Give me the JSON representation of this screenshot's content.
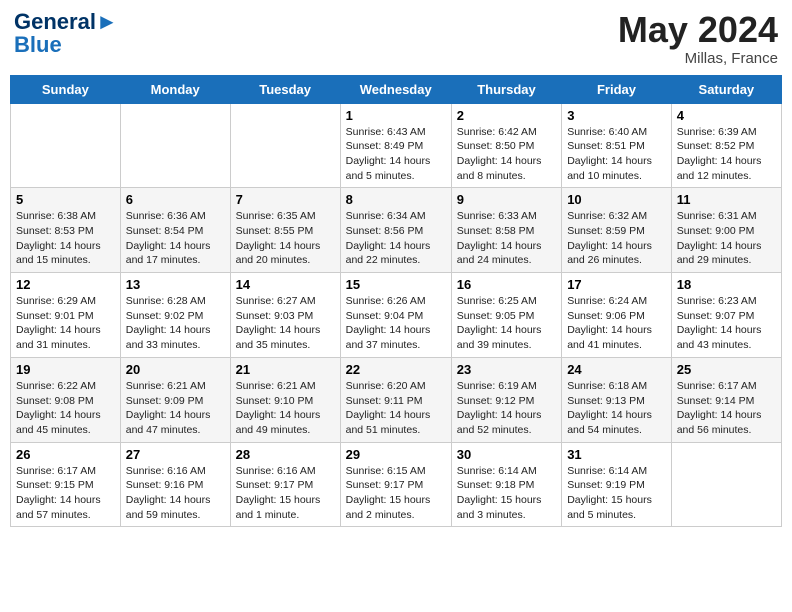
{
  "header": {
    "logo_line1": "General",
    "logo_line2": "Blue",
    "month": "May 2024",
    "location": "Millas, France"
  },
  "weekdays": [
    "Sunday",
    "Monday",
    "Tuesday",
    "Wednesday",
    "Thursday",
    "Friday",
    "Saturday"
  ],
  "weeks": [
    [
      {
        "day": "",
        "info": ""
      },
      {
        "day": "",
        "info": ""
      },
      {
        "day": "",
        "info": ""
      },
      {
        "day": "1",
        "info": "Sunrise: 6:43 AM\nSunset: 8:49 PM\nDaylight: 14 hours\nand 5 minutes."
      },
      {
        "day": "2",
        "info": "Sunrise: 6:42 AM\nSunset: 8:50 PM\nDaylight: 14 hours\nand 8 minutes."
      },
      {
        "day": "3",
        "info": "Sunrise: 6:40 AM\nSunset: 8:51 PM\nDaylight: 14 hours\nand 10 minutes."
      },
      {
        "day": "4",
        "info": "Sunrise: 6:39 AM\nSunset: 8:52 PM\nDaylight: 14 hours\nand 12 minutes."
      }
    ],
    [
      {
        "day": "5",
        "info": "Sunrise: 6:38 AM\nSunset: 8:53 PM\nDaylight: 14 hours\nand 15 minutes."
      },
      {
        "day": "6",
        "info": "Sunrise: 6:36 AM\nSunset: 8:54 PM\nDaylight: 14 hours\nand 17 minutes."
      },
      {
        "day": "7",
        "info": "Sunrise: 6:35 AM\nSunset: 8:55 PM\nDaylight: 14 hours\nand 20 minutes."
      },
      {
        "day": "8",
        "info": "Sunrise: 6:34 AM\nSunset: 8:56 PM\nDaylight: 14 hours\nand 22 minutes."
      },
      {
        "day": "9",
        "info": "Sunrise: 6:33 AM\nSunset: 8:58 PM\nDaylight: 14 hours\nand 24 minutes."
      },
      {
        "day": "10",
        "info": "Sunrise: 6:32 AM\nSunset: 8:59 PM\nDaylight: 14 hours\nand 26 minutes."
      },
      {
        "day": "11",
        "info": "Sunrise: 6:31 AM\nSunset: 9:00 PM\nDaylight: 14 hours\nand 29 minutes."
      }
    ],
    [
      {
        "day": "12",
        "info": "Sunrise: 6:29 AM\nSunset: 9:01 PM\nDaylight: 14 hours\nand 31 minutes."
      },
      {
        "day": "13",
        "info": "Sunrise: 6:28 AM\nSunset: 9:02 PM\nDaylight: 14 hours\nand 33 minutes."
      },
      {
        "day": "14",
        "info": "Sunrise: 6:27 AM\nSunset: 9:03 PM\nDaylight: 14 hours\nand 35 minutes."
      },
      {
        "day": "15",
        "info": "Sunrise: 6:26 AM\nSunset: 9:04 PM\nDaylight: 14 hours\nand 37 minutes."
      },
      {
        "day": "16",
        "info": "Sunrise: 6:25 AM\nSunset: 9:05 PM\nDaylight: 14 hours\nand 39 minutes."
      },
      {
        "day": "17",
        "info": "Sunrise: 6:24 AM\nSunset: 9:06 PM\nDaylight: 14 hours\nand 41 minutes."
      },
      {
        "day": "18",
        "info": "Sunrise: 6:23 AM\nSunset: 9:07 PM\nDaylight: 14 hours\nand 43 minutes."
      }
    ],
    [
      {
        "day": "19",
        "info": "Sunrise: 6:22 AM\nSunset: 9:08 PM\nDaylight: 14 hours\nand 45 minutes."
      },
      {
        "day": "20",
        "info": "Sunrise: 6:21 AM\nSunset: 9:09 PM\nDaylight: 14 hours\nand 47 minutes."
      },
      {
        "day": "21",
        "info": "Sunrise: 6:21 AM\nSunset: 9:10 PM\nDaylight: 14 hours\nand 49 minutes."
      },
      {
        "day": "22",
        "info": "Sunrise: 6:20 AM\nSunset: 9:11 PM\nDaylight: 14 hours\nand 51 minutes."
      },
      {
        "day": "23",
        "info": "Sunrise: 6:19 AM\nSunset: 9:12 PM\nDaylight: 14 hours\nand 52 minutes."
      },
      {
        "day": "24",
        "info": "Sunrise: 6:18 AM\nSunset: 9:13 PM\nDaylight: 14 hours\nand 54 minutes."
      },
      {
        "day": "25",
        "info": "Sunrise: 6:17 AM\nSunset: 9:14 PM\nDaylight: 14 hours\nand 56 minutes."
      }
    ],
    [
      {
        "day": "26",
        "info": "Sunrise: 6:17 AM\nSunset: 9:15 PM\nDaylight: 14 hours\nand 57 minutes."
      },
      {
        "day": "27",
        "info": "Sunrise: 6:16 AM\nSunset: 9:16 PM\nDaylight: 14 hours\nand 59 minutes."
      },
      {
        "day": "28",
        "info": "Sunrise: 6:16 AM\nSunset: 9:17 PM\nDaylight: 15 hours\nand 1 minute."
      },
      {
        "day": "29",
        "info": "Sunrise: 6:15 AM\nSunset: 9:17 PM\nDaylight: 15 hours\nand 2 minutes."
      },
      {
        "day": "30",
        "info": "Sunrise: 6:14 AM\nSunset: 9:18 PM\nDaylight: 15 hours\nand 3 minutes."
      },
      {
        "day": "31",
        "info": "Sunrise: 6:14 AM\nSunset: 9:19 PM\nDaylight: 15 hours\nand 5 minutes."
      },
      {
        "day": "",
        "info": ""
      }
    ]
  ]
}
